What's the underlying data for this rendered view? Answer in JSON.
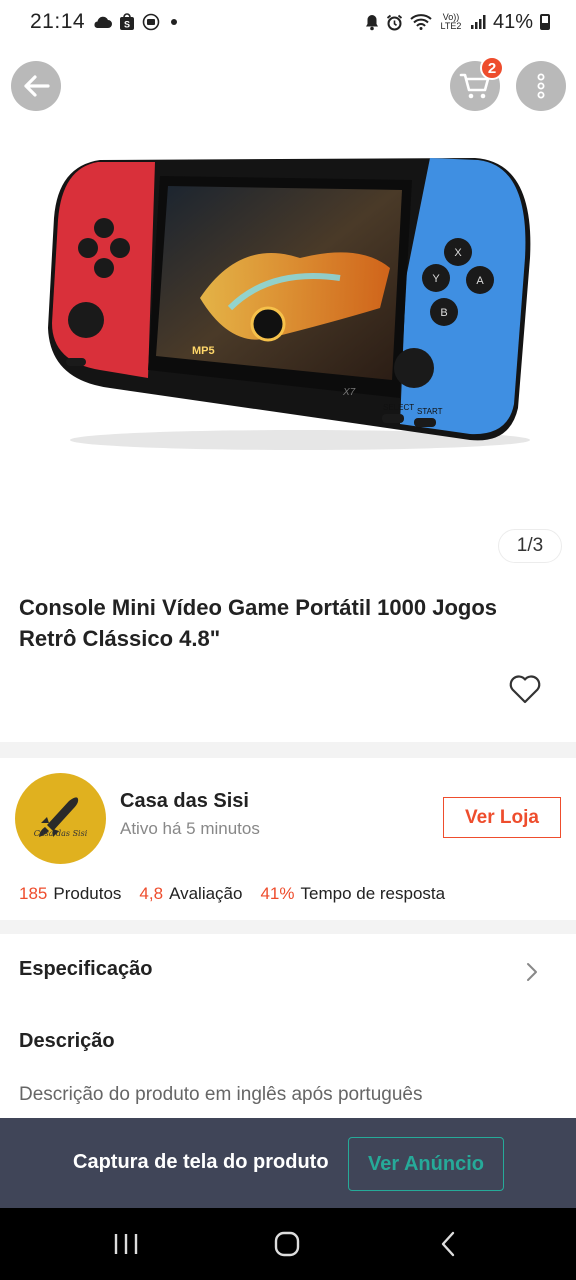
{
  "status_bar": {
    "time": "21:14",
    "volte": "Vo)) LTE2",
    "battery": "41%",
    "left_icons": [
      "cloud-icon",
      "shopee-notification-icon",
      "media-icon",
      "dot-icon"
    ],
    "right_icons": [
      "alarm-icon",
      "alarm-clock-icon",
      "wifi-icon",
      "signal-icon",
      "battery-icon"
    ]
  },
  "header": {
    "cart_count": "2",
    "icons": [
      "back-arrow-icon",
      "cart-icon",
      "more-vertical-icon"
    ]
  },
  "gallery": {
    "image": "handheld-game-console-image",
    "counter": "1/3",
    "screen_label": "MP5",
    "model_label": "X7",
    "select_label": "SELECT",
    "start_label": "START",
    "button_letters": [
      "X",
      "Y",
      "A",
      "B"
    ]
  },
  "product": {
    "title": "Console Mini Vídeo Game Portátil 1000 Jogos Retrô Clássico 4.8\""
  },
  "shop": {
    "name": "Casa das Sisi",
    "status": "Ativo há 5 minutos",
    "button": "Ver Loja",
    "avatar_text": "Casa das Sisi",
    "stats": [
      {
        "value": "185",
        "label": "Produtos"
      },
      {
        "value": "4,8",
        "label": "Avaliação"
      },
      {
        "value": "41%",
        "label": "Tempo de resposta"
      }
    ]
  },
  "sections": {
    "spec_label": "Especificação",
    "desc_title": "Descrição",
    "desc_text": "Descrição do produto em inglês após português"
  },
  "bottom_bar": {
    "text": "Captura de tela do produto",
    "button": "Ver Anúncio"
  },
  "colors": {
    "accent": "#ee4d2d",
    "teal": "#26aa99",
    "bottom_bar_bg": "#404558",
    "avatar_bg": "#e0b11f"
  }
}
